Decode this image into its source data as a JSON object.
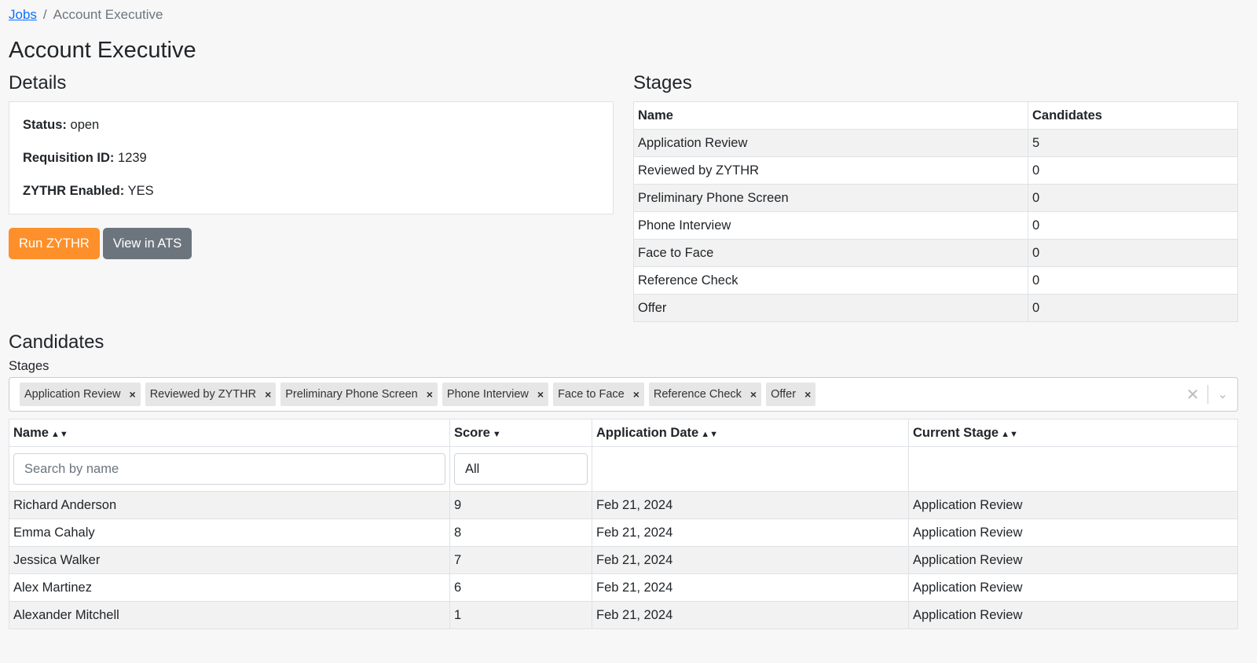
{
  "breadcrumb": {
    "parent": "Jobs",
    "separator": "/",
    "current": "Account Executive"
  },
  "title": "Account Executive",
  "details": {
    "heading": "Details",
    "status_label": "Status:",
    "status_value": "open",
    "req_label": "Requisition ID:",
    "req_value": "1239",
    "zythr_label": "ZYTHR Enabled:",
    "zythr_value": "YES"
  },
  "buttons": {
    "run": "Run ZYTHR",
    "ats": "View in ATS"
  },
  "stages": {
    "heading": "Stages",
    "col_name": "Name",
    "col_candidates": "Candidates",
    "rows": [
      {
        "name": "Application Review",
        "count": "5"
      },
      {
        "name": "Reviewed by ZYTHR",
        "count": "0"
      },
      {
        "name": "Preliminary Phone Screen",
        "count": "0"
      },
      {
        "name": "Phone Interview",
        "count": "0"
      },
      {
        "name": "Face to Face",
        "count": "0"
      },
      {
        "name": "Reference Check",
        "count": "0"
      },
      {
        "name": "Offer",
        "count": "0"
      }
    ]
  },
  "candidates": {
    "heading": "Candidates",
    "stages_label": "Stages",
    "chips": [
      "Application Review",
      "Reviewed by ZYTHR",
      "Preliminary Phone Screen",
      "Phone Interview",
      "Face to Face",
      "Reference Check",
      "Offer"
    ],
    "chip_remove": "×",
    "clear_icon": "✕",
    "chevron_icon": "⌄",
    "cols": {
      "name": "Name",
      "score": "Score",
      "date": "Application Date",
      "stage": "Current Stage"
    },
    "sort_both": "▲▼",
    "sort_desc": "▼",
    "search_placeholder": "Search by name",
    "score_filter": "All",
    "rows": [
      {
        "name": "Richard Anderson",
        "score": "9",
        "date": "Feb 21, 2024",
        "stage": "Application Review"
      },
      {
        "name": "Emma Cahaly",
        "score": "8",
        "date": "Feb 21, 2024",
        "stage": "Application Review"
      },
      {
        "name": "Jessica Walker",
        "score": "7",
        "date": "Feb 21, 2024",
        "stage": "Application Review"
      },
      {
        "name": "Alex Martinez",
        "score": "6",
        "date": "Feb 21, 2024",
        "stage": "Application Review"
      },
      {
        "name": "Alexander Mitchell",
        "score": "1",
        "date": "Feb 21, 2024",
        "stage": "Application Review"
      }
    ]
  }
}
